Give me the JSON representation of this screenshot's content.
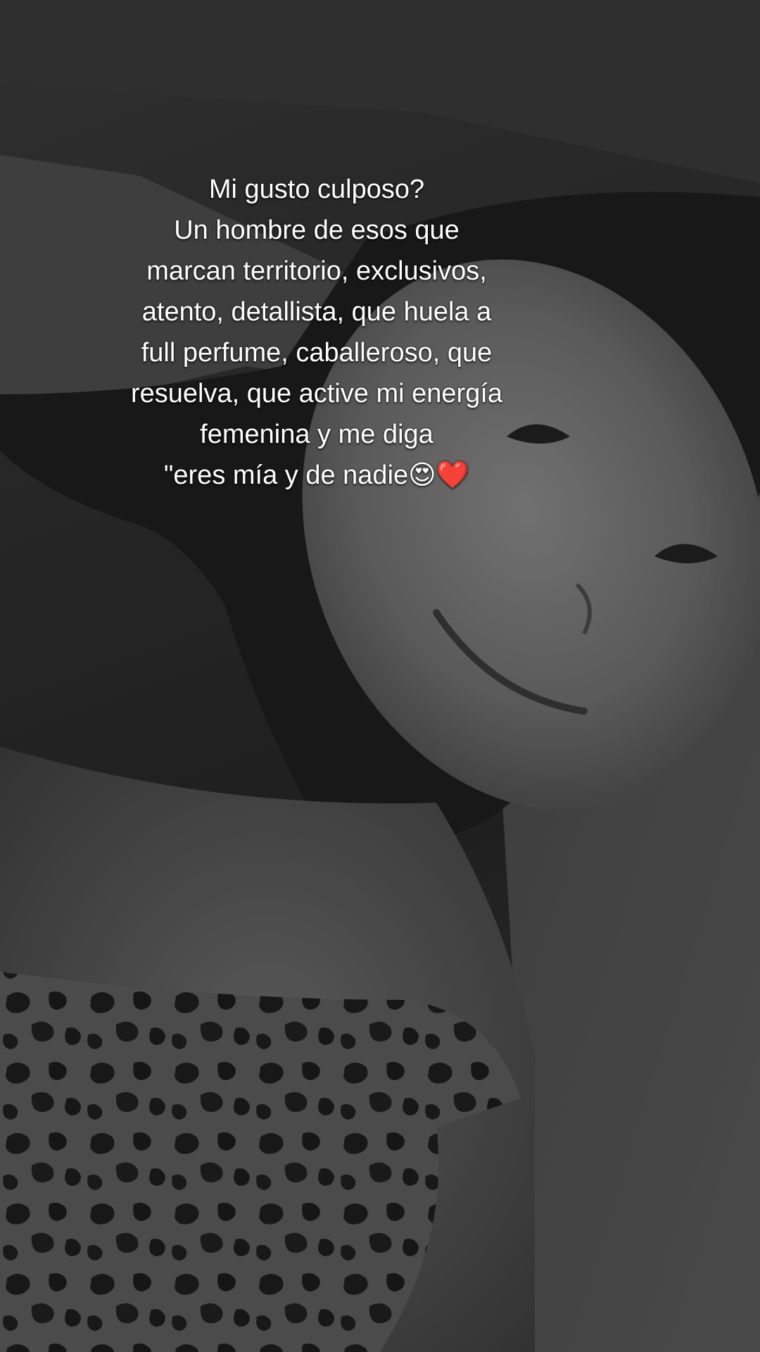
{
  "caption": {
    "lines": [
      "Mi gusto culposo?",
      "Un hombre de esos que",
      "marcan territorio, exclusivos,",
      "atento, detallista, que huela a",
      "full perfume, caballeroso, que",
      "resuelva, que active mi energía",
      "femenina y me diga",
      "\"eres mía y de nadie😍❤️"
    ]
  },
  "photo": {
    "subject": "black-and-white selfie of a smiling woman lying on a pillow",
    "top_pattern": "leopard print"
  }
}
